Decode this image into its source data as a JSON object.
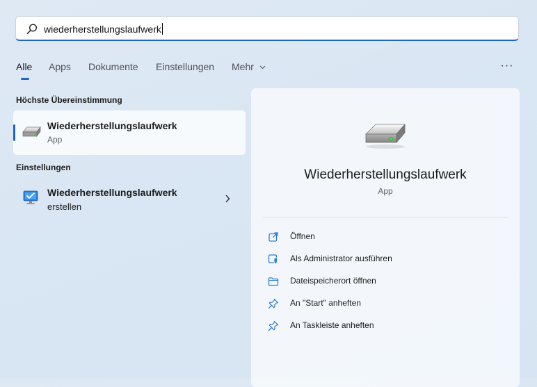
{
  "search": {
    "query": "wiederherstellungslaufwerk",
    "icon": "search-icon"
  },
  "tabs": [
    {
      "label": "Alle",
      "active": true
    },
    {
      "label": "Apps"
    },
    {
      "label": "Dokumente"
    },
    {
      "label": "Einstellungen"
    },
    {
      "label": "Mehr",
      "icon": "chevron-down-icon"
    }
  ],
  "more_options": {
    "label": "···",
    "icon": "more-icon"
  },
  "best_match": {
    "heading": "Höchste Übereinstimmung",
    "title": "Wiederherstellungslaufwerk",
    "subtitle": "App",
    "icon": "drive-icon"
  },
  "settings_section": {
    "heading": "Einstellungen",
    "title": "Wiederherstellungslaufwerk",
    "subtitle": "erstellen",
    "icon": "monitor-check-icon"
  },
  "detail": {
    "title": "Wiederherstellungslaufwerk",
    "subtitle": "App",
    "icon": "drive-icon",
    "actions": [
      {
        "label": "Öffnen",
        "icon": "open-icon"
      },
      {
        "label": "Als Administrator ausführen",
        "icon": "shield-icon"
      },
      {
        "label": "Dateispeicherort öffnen",
        "icon": "folder-icon"
      },
      {
        "label": "An \"Start\" anheften",
        "icon": "pin-icon"
      },
      {
        "label": "An Taskleiste anheften",
        "icon": "pin-icon"
      }
    ]
  },
  "colors": {
    "accent": "#1f66c4",
    "icon_blue": "#2b7cd3"
  }
}
